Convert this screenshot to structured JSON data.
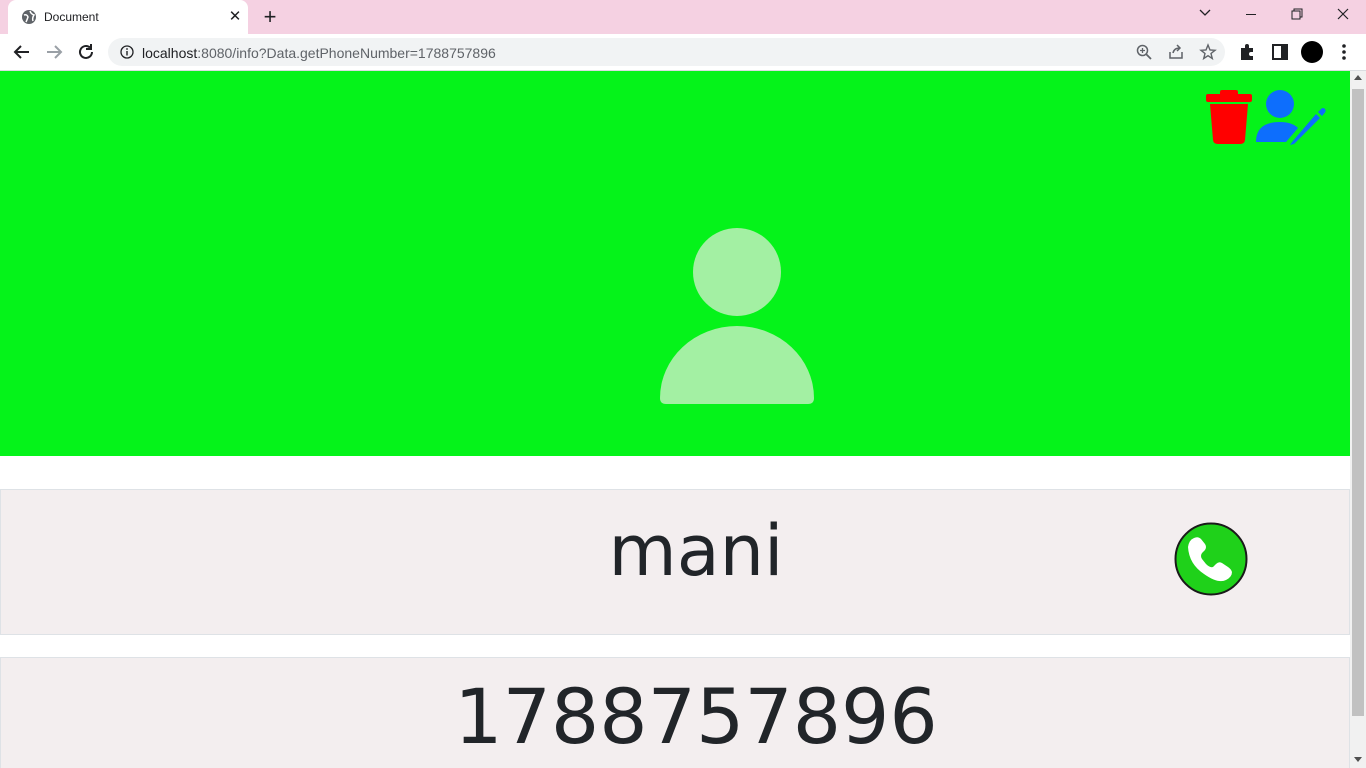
{
  "browser": {
    "tab_title": "Document",
    "url_host": "localhost",
    "url_rest": ":8080/info?Data.getPhoneNumber=1788757896"
  },
  "contact": {
    "name": "mani",
    "phone": "1788757896"
  },
  "colors": {
    "hero": "#05f31a",
    "delete": "#ff0000",
    "edit": "#0d6efd",
    "call": "#1fd11a"
  },
  "icons": {
    "delete": "trash-icon",
    "edit": "user-edit-icon",
    "call": "phone-icon",
    "avatar": "user-icon"
  }
}
